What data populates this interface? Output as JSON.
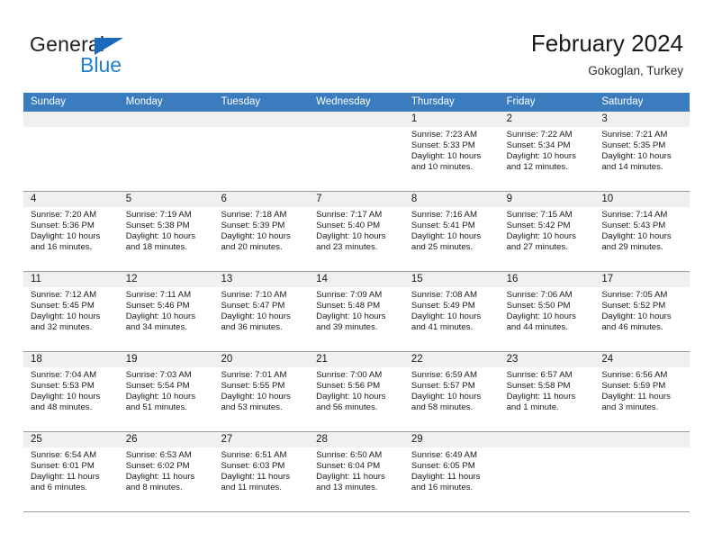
{
  "brand": {
    "name_part1": "General",
    "name_part2": "Blue"
  },
  "header": {
    "title": "February 2024",
    "subtitle": "Gokoglan, Turkey"
  },
  "weekdays": [
    "Sunday",
    "Monday",
    "Tuesday",
    "Wednesday",
    "Thursday",
    "Friday",
    "Saturday"
  ],
  "colors": {
    "header_blue": "#3b7cbf",
    "brand_blue": "#1f7fd0",
    "day_band_gray": "#f0f0f0",
    "grid_line": "#9b9b9b"
  },
  "labels": {
    "sunrise_prefix": "Sunrise: ",
    "sunset_prefix": "Sunset: ",
    "daylight_prefix": "Daylight: "
  },
  "weeks": [
    [
      {
        "empty": true
      },
      {
        "empty": true
      },
      {
        "empty": true
      },
      {
        "empty": true
      },
      {
        "date": "1",
        "sunrise": "Sunrise: 7:23 AM",
        "sunset": "Sunset: 5:33 PM",
        "daylight": "Daylight: 10 hours and 10 minutes."
      },
      {
        "date": "2",
        "sunrise": "Sunrise: 7:22 AM",
        "sunset": "Sunset: 5:34 PM",
        "daylight": "Daylight: 10 hours and 12 minutes."
      },
      {
        "date": "3",
        "sunrise": "Sunrise: 7:21 AM",
        "sunset": "Sunset: 5:35 PM",
        "daylight": "Daylight: 10 hours and 14 minutes."
      }
    ],
    [
      {
        "date": "4",
        "sunrise": "Sunrise: 7:20 AM",
        "sunset": "Sunset: 5:36 PM",
        "daylight": "Daylight: 10 hours and 16 minutes."
      },
      {
        "date": "5",
        "sunrise": "Sunrise: 7:19 AM",
        "sunset": "Sunset: 5:38 PM",
        "daylight": "Daylight: 10 hours and 18 minutes."
      },
      {
        "date": "6",
        "sunrise": "Sunrise: 7:18 AM",
        "sunset": "Sunset: 5:39 PM",
        "daylight": "Daylight: 10 hours and 20 minutes."
      },
      {
        "date": "7",
        "sunrise": "Sunrise: 7:17 AM",
        "sunset": "Sunset: 5:40 PM",
        "daylight": "Daylight: 10 hours and 23 minutes."
      },
      {
        "date": "8",
        "sunrise": "Sunrise: 7:16 AM",
        "sunset": "Sunset: 5:41 PM",
        "daylight": "Daylight: 10 hours and 25 minutes."
      },
      {
        "date": "9",
        "sunrise": "Sunrise: 7:15 AM",
        "sunset": "Sunset: 5:42 PM",
        "daylight": "Daylight: 10 hours and 27 minutes."
      },
      {
        "date": "10",
        "sunrise": "Sunrise: 7:14 AM",
        "sunset": "Sunset: 5:43 PM",
        "daylight": "Daylight: 10 hours and 29 minutes."
      }
    ],
    [
      {
        "date": "11",
        "sunrise": "Sunrise: 7:12 AM",
        "sunset": "Sunset: 5:45 PM",
        "daylight": "Daylight: 10 hours and 32 minutes."
      },
      {
        "date": "12",
        "sunrise": "Sunrise: 7:11 AM",
        "sunset": "Sunset: 5:46 PM",
        "daylight": "Daylight: 10 hours and 34 minutes."
      },
      {
        "date": "13",
        "sunrise": "Sunrise: 7:10 AM",
        "sunset": "Sunset: 5:47 PM",
        "daylight": "Daylight: 10 hours and 36 minutes."
      },
      {
        "date": "14",
        "sunrise": "Sunrise: 7:09 AM",
        "sunset": "Sunset: 5:48 PM",
        "daylight": "Daylight: 10 hours and 39 minutes."
      },
      {
        "date": "15",
        "sunrise": "Sunrise: 7:08 AM",
        "sunset": "Sunset: 5:49 PM",
        "daylight": "Daylight: 10 hours and 41 minutes."
      },
      {
        "date": "16",
        "sunrise": "Sunrise: 7:06 AM",
        "sunset": "Sunset: 5:50 PM",
        "daylight": "Daylight: 10 hours and 44 minutes."
      },
      {
        "date": "17",
        "sunrise": "Sunrise: 7:05 AM",
        "sunset": "Sunset: 5:52 PM",
        "daylight": "Daylight: 10 hours and 46 minutes."
      }
    ],
    [
      {
        "date": "18",
        "sunrise": "Sunrise: 7:04 AM",
        "sunset": "Sunset: 5:53 PM",
        "daylight": "Daylight: 10 hours and 48 minutes."
      },
      {
        "date": "19",
        "sunrise": "Sunrise: 7:03 AM",
        "sunset": "Sunset: 5:54 PM",
        "daylight": "Daylight: 10 hours and 51 minutes."
      },
      {
        "date": "20",
        "sunrise": "Sunrise: 7:01 AM",
        "sunset": "Sunset: 5:55 PM",
        "daylight": "Daylight: 10 hours and 53 minutes."
      },
      {
        "date": "21",
        "sunrise": "Sunrise: 7:00 AM",
        "sunset": "Sunset: 5:56 PM",
        "daylight": "Daylight: 10 hours and 56 minutes."
      },
      {
        "date": "22",
        "sunrise": "Sunrise: 6:59 AM",
        "sunset": "Sunset: 5:57 PM",
        "daylight": "Daylight: 10 hours and 58 minutes."
      },
      {
        "date": "23",
        "sunrise": "Sunrise: 6:57 AM",
        "sunset": "Sunset: 5:58 PM",
        "daylight": "Daylight: 11 hours and 1 minute."
      },
      {
        "date": "24",
        "sunrise": "Sunrise: 6:56 AM",
        "sunset": "Sunset: 5:59 PM",
        "daylight": "Daylight: 11 hours and 3 minutes."
      }
    ],
    [
      {
        "date": "25",
        "sunrise": "Sunrise: 6:54 AM",
        "sunset": "Sunset: 6:01 PM",
        "daylight": "Daylight: 11 hours and 6 minutes."
      },
      {
        "date": "26",
        "sunrise": "Sunrise: 6:53 AM",
        "sunset": "Sunset: 6:02 PM",
        "daylight": "Daylight: 11 hours and 8 minutes."
      },
      {
        "date": "27",
        "sunrise": "Sunrise: 6:51 AM",
        "sunset": "Sunset: 6:03 PM",
        "daylight": "Daylight: 11 hours and 11 minutes."
      },
      {
        "date": "28",
        "sunrise": "Sunrise: 6:50 AM",
        "sunset": "Sunset: 6:04 PM",
        "daylight": "Daylight: 11 hours and 13 minutes."
      },
      {
        "date": "29",
        "sunrise": "Sunrise: 6:49 AM",
        "sunset": "Sunset: 6:05 PM",
        "daylight": "Daylight: 11 hours and 16 minutes."
      },
      {
        "empty": true
      },
      {
        "empty": true
      }
    ]
  ]
}
